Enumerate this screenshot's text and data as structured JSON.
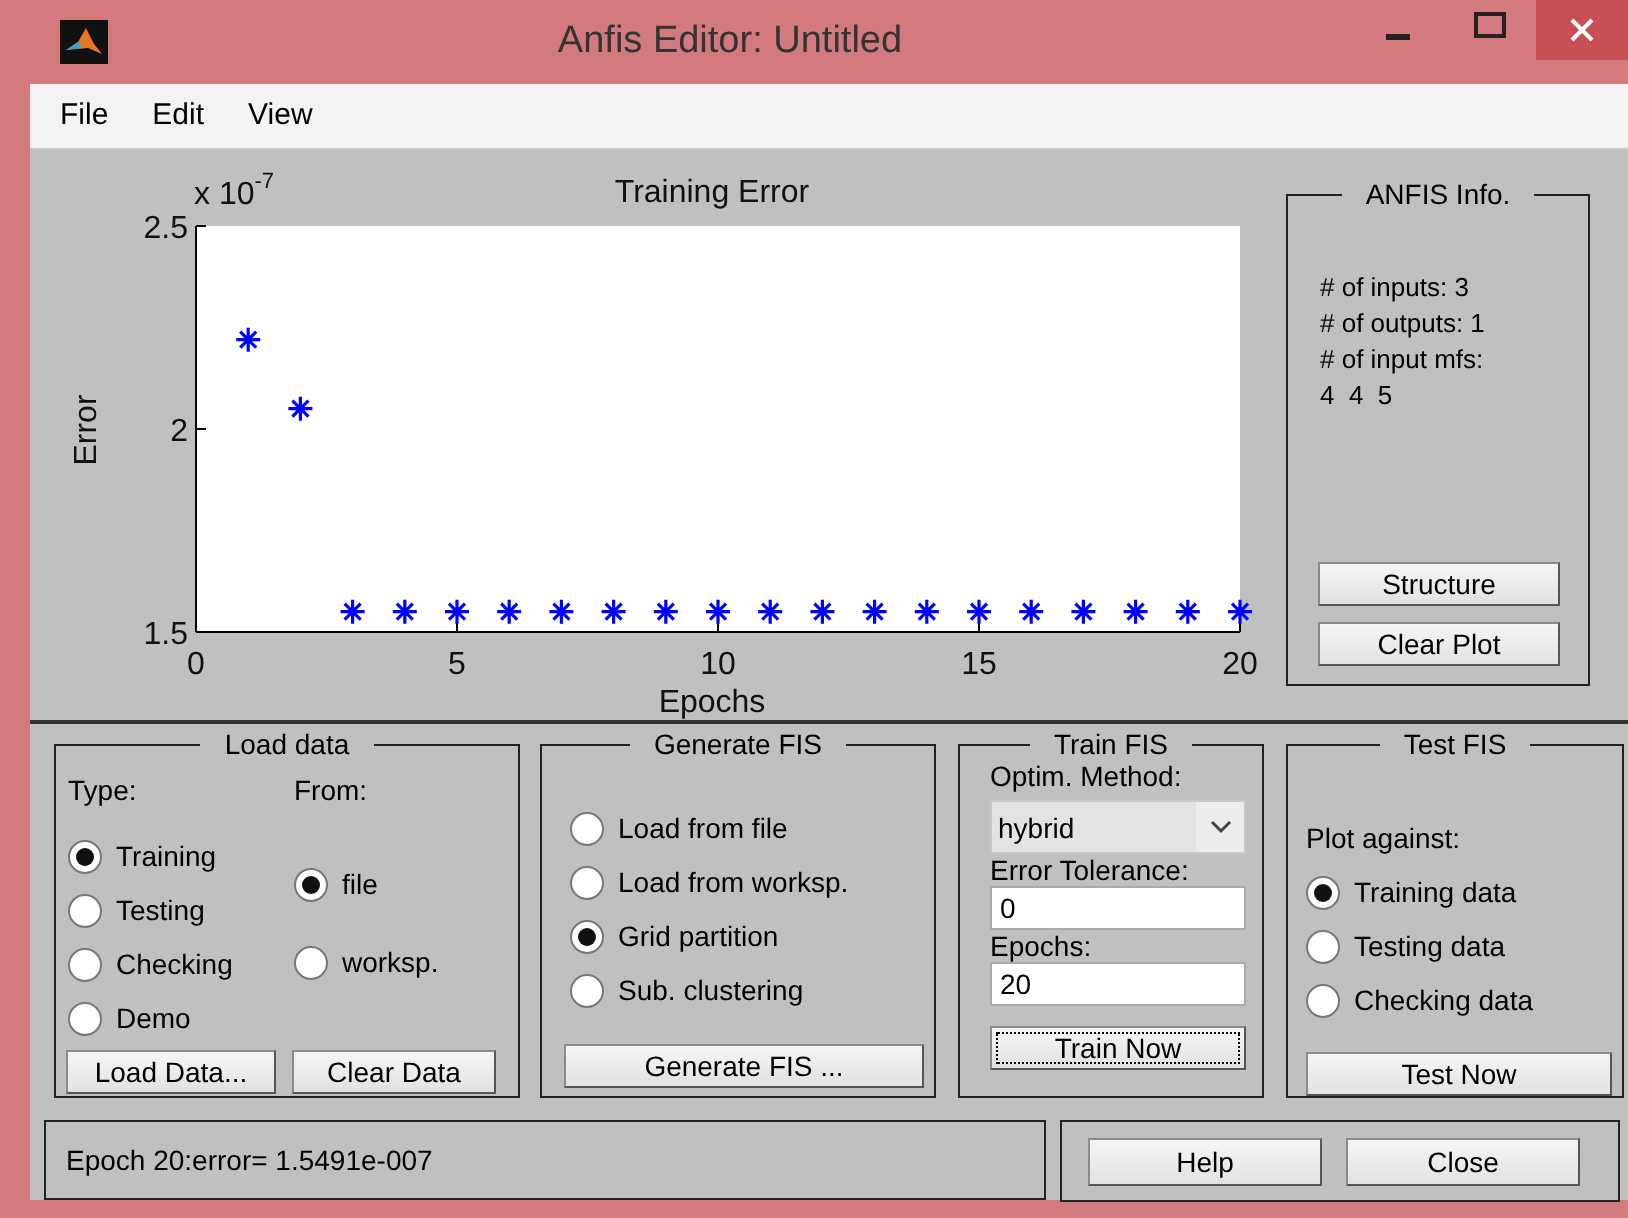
{
  "window": {
    "title": "Anfis Editor: Untitled"
  },
  "menu": [
    "File",
    "Edit",
    "View"
  ],
  "plot": {
    "multiplier": "x 10",
    "exponent": "-7",
    "chart_data": {
      "type": "scatter",
      "title": "Training Error",
      "xlabel": "Epochs",
      "ylabel": "Error",
      "x": [
        1,
        2,
        3,
        4,
        5,
        6,
        7,
        8,
        9,
        10,
        11,
        12,
        13,
        14,
        15,
        16,
        17,
        18,
        19,
        20
      ],
      "series": [
        {
          "color": "#0000ff",
          "values": [
            2.22,
            2.05,
            1.55,
            1.55,
            1.55,
            1.55,
            1.55,
            1.55,
            1.55,
            1.55,
            1.55,
            1.55,
            1.55,
            1.55,
            1.55,
            1.55,
            1.55,
            1.55,
            1.55,
            1.55
          ]
        }
      ],
      "xlim": [
        0,
        20
      ],
      "ylim": [
        1.5,
        2.5
      ],
      "xticks": [
        0,
        5,
        10,
        15,
        20
      ],
      "yticks": [
        1.5,
        2,
        2.5
      ]
    }
  },
  "anfis_info": {
    "title": "ANFIS Info.",
    "lines": [
      "# of inputs: 3",
      "# of outputs: 1",
      "# of input mfs:",
      "4  4  5"
    ],
    "buttons": [
      "Structure",
      "Clear Plot"
    ]
  },
  "load_data": {
    "title": "Load data",
    "type_label": "Type:",
    "types": [
      {
        "label": "Training",
        "selected": true
      },
      {
        "label": "Testing",
        "selected": false
      },
      {
        "label": "Checking",
        "selected": false
      },
      {
        "label": "Demo",
        "selected": false
      }
    ],
    "from_label": "From:",
    "sources": [
      {
        "label": "file",
        "selected": true
      },
      {
        "label": "worksp.",
        "selected": false
      }
    ],
    "buttons": [
      "Load Data...",
      "Clear Data"
    ]
  },
  "generate_fis": {
    "title": "Generate FIS",
    "options": [
      {
        "label": "Load from file",
        "selected": false
      },
      {
        "label": "Load from worksp.",
        "selected": false
      },
      {
        "label": "Grid partition",
        "selected": true
      },
      {
        "label": "Sub. clustering",
        "selected": false
      }
    ],
    "button": "Generate FIS ..."
  },
  "train_fis": {
    "title": "Train FIS",
    "method_label": "Optim. Method:",
    "method": "hybrid",
    "tolerance_label": "Error Tolerance:",
    "tolerance": "0",
    "epochs_label": "Epochs:",
    "epochs": "20",
    "button": {
      "label": "Train Now",
      "focused": true
    }
  },
  "test_fis": {
    "title": "Test FIS",
    "plot_label": "Plot against:",
    "options": [
      {
        "label": "Training data",
        "selected": true
      },
      {
        "label": "Testing data",
        "selected": false
      },
      {
        "label": "Checking data",
        "selected": false
      }
    ],
    "button": "Test Now"
  },
  "status": "Epoch 20:error= 1.5491e-007",
  "footer_buttons": [
    "Help",
    "Close"
  ]
}
